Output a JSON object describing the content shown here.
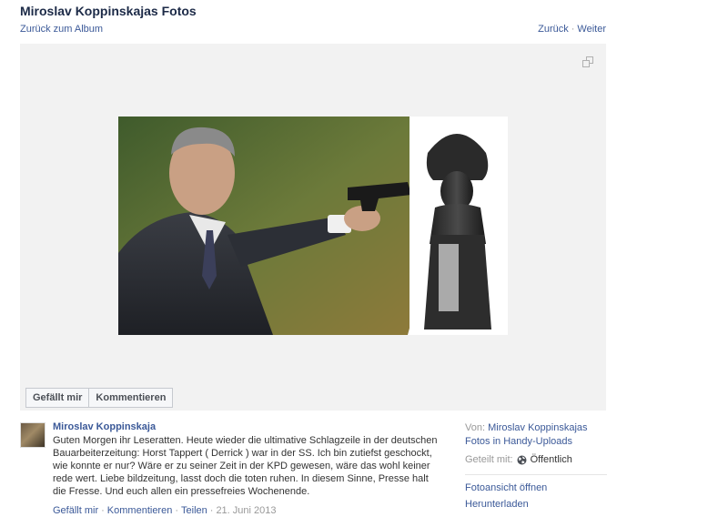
{
  "header": {
    "title": "Miroslav Koppinskajas Fotos",
    "back_to_album": "Zurück zum Album",
    "prev": "Zurück",
    "next": "Weiter",
    "separator": "·"
  },
  "stage": {
    "fullscreen_icon": "expand-icon",
    "like_button": "Gefällt mir",
    "comment_button": "Kommentieren"
  },
  "post": {
    "author": "Miroslav Koppinskaja",
    "text": "Guten Morgen ihr Leseratten. Heute wieder die ultimative Schlagzeile in der deutschen Bauarbeiterzeitung: Horst Tappert ( Derrick ) war in der SS. Ich bin zutiefst geschockt, wie konnte er nur? Wäre er zu seiner Zeit in der KPD gewesen, wäre das wohl keiner rede wert. Liebe bildzeitung, lasst doch die toten ruhen. In diesem Sinne, Presse halt die Fresse. Und euch allen ein pressefreies Wochenende.",
    "actions": {
      "like": "Gefällt mir",
      "comment": "Kommentieren",
      "share": "Teilen",
      "date": "21. Juni 2013",
      "separator": "·"
    }
  },
  "sidebar": {
    "from_label": "Von:",
    "album_link": "Miroslav Koppinskajas Fotos",
    "in_word": "in",
    "uploads_link": "Handy-Uploads",
    "shared_label": "Geteilt mit:",
    "shared_value": "Öffentlich",
    "globe_icon": "globe-icon",
    "open_photo_view": "Fotoansicht öffnen",
    "download": "Herunterladen"
  }
}
